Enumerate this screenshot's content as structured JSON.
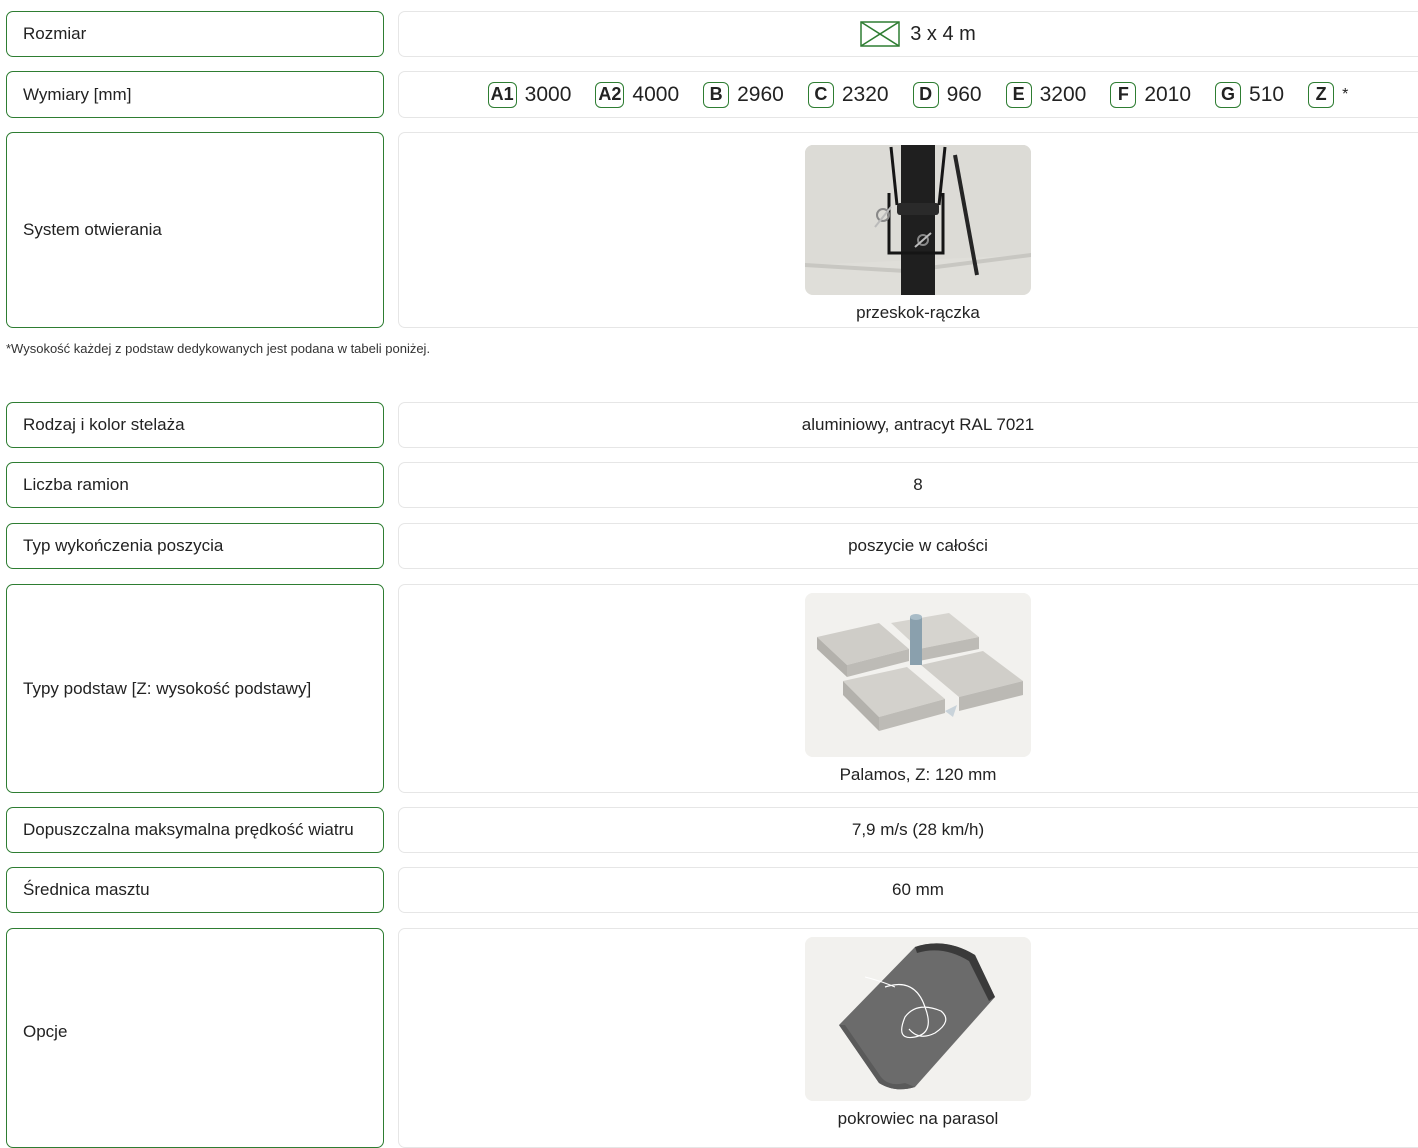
{
  "rows": [
    {
      "label": "Rozmiar",
      "value": "3 x 4 m"
    },
    {
      "label": "Wymiary [mm]"
    },
    {
      "label": "System otwierania",
      "caption": "przeskok-rączka"
    },
    {
      "label": "Rodzaj i kolor stelaża",
      "value": "aluminiowy, antracyt RAL 7021"
    },
    {
      "label": "Liczba ramion",
      "value": "8"
    },
    {
      "label": "Typ wykończenia poszycia",
      "value": "poszycie w całości"
    },
    {
      "label": "Typy podstaw [Z: wysokość podstawy]",
      "caption": "Palamos, Z: 120 mm"
    },
    {
      "label": "Dopuszczalna maksymalna prędkość wiatru",
      "value": "7,9 m/s (28 km/h)"
    },
    {
      "label": "Średnica masztu",
      "value": "60 mm"
    },
    {
      "label": "Opcje",
      "caption": "pokrowiec na parasol"
    }
  ],
  "dimensions": [
    {
      "key": "A1",
      "value": "3000"
    },
    {
      "key": "A2",
      "value": "4000"
    },
    {
      "key": "B",
      "value": "2960"
    },
    {
      "key": "C",
      "value": "2320"
    },
    {
      "key": "D",
      "value": "960"
    },
    {
      "key": "E",
      "value": "3200"
    },
    {
      "key": "F",
      "value": "2010"
    },
    {
      "key": "G",
      "value": "510"
    },
    {
      "key": "Z",
      "value": "*"
    }
  ],
  "footnote": "*Wysokość każdej z podstaw dedykowanych jest podana w tabeli poniżej.",
  "colors": {
    "accent": "#2e7d32",
    "border": "#e6e6e6"
  },
  "icons": {
    "size": "rectangle-crossed-icon"
  }
}
